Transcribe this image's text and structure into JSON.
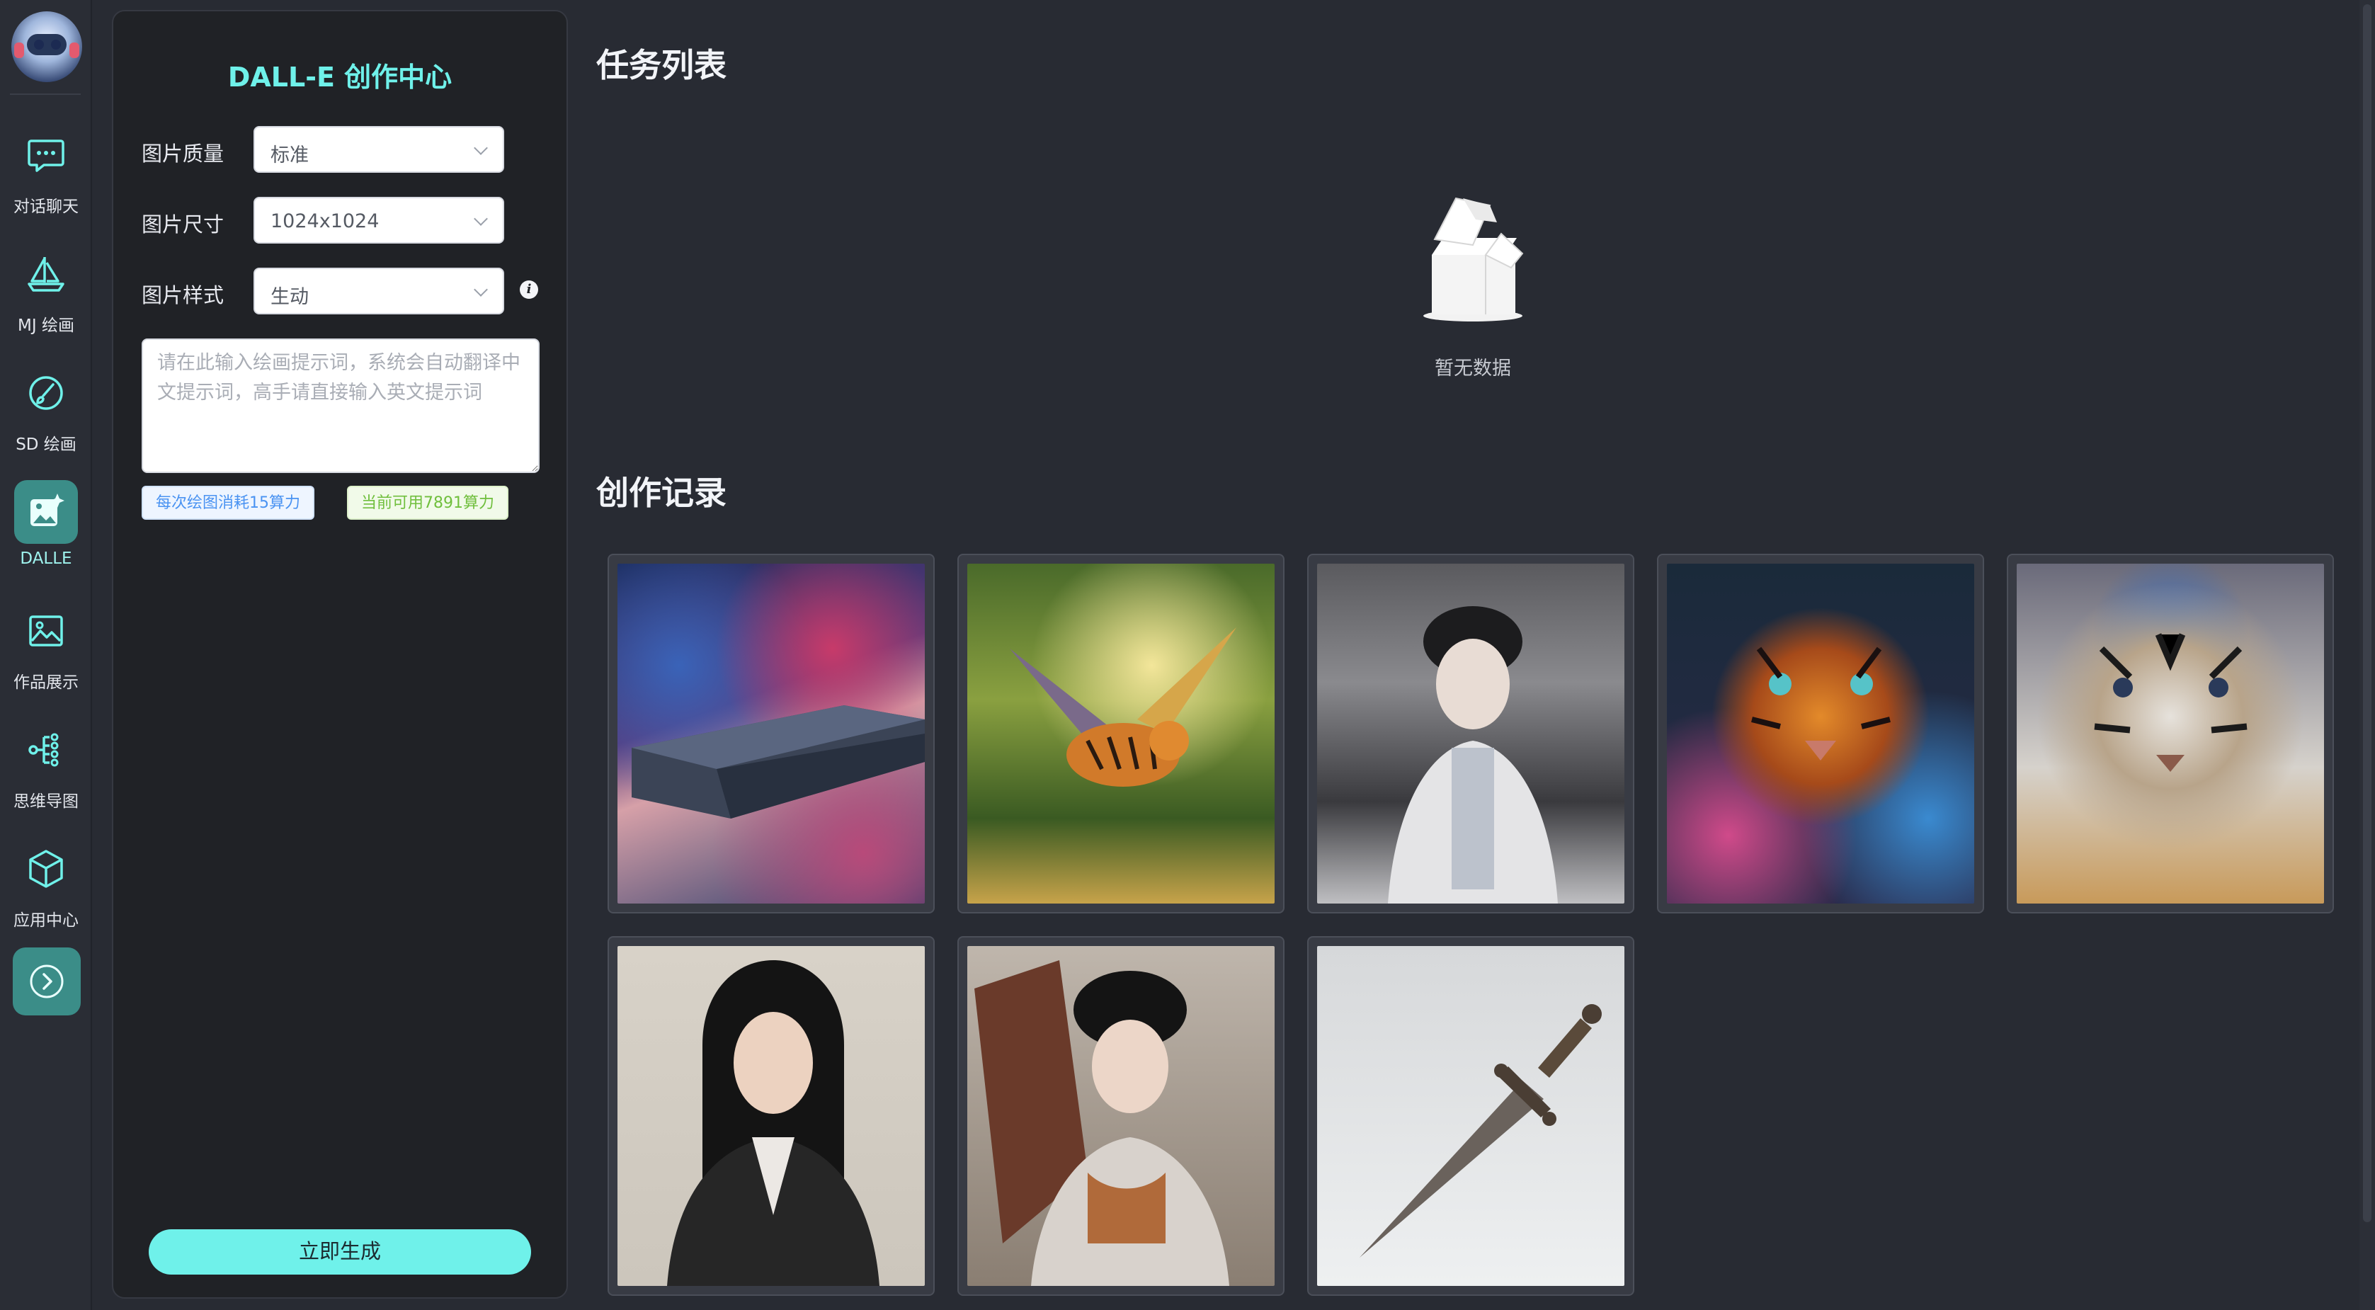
{
  "nav": {
    "items": [
      {
        "label": "对话聊天",
        "icon": "chat-icon"
      },
      {
        "label": "MJ 绘画",
        "icon": "sailboat-icon"
      },
      {
        "label": "SD 绘画",
        "icon": "brush-icon"
      },
      {
        "label": "DALLE",
        "icon": "image-sparkle-icon",
        "active": true
      },
      {
        "label": "作品展示",
        "icon": "gallery-icon"
      },
      {
        "label": "思维导图",
        "icon": "mindmap-icon"
      },
      {
        "label": "应用中心",
        "icon": "cube-icon"
      }
    ],
    "expand_icon": "chevron-right-circle-icon"
  },
  "panel": {
    "title": "DALL-E 创作中心",
    "quality": {
      "label": "图片质量",
      "value": "标准"
    },
    "size": {
      "label": "图片尺寸",
      "value": "1024x1024"
    },
    "style": {
      "label": "图片样式",
      "value": "生动"
    },
    "prompt_placeholder": "请在此输入绘画提示词，系统会自动翻译中文提示词，高手请直接输入英文提示词",
    "cost_tag": "每次绘图消耗15算力",
    "balance_tag": "当前可用7891算力",
    "generate_label": "立即生成"
  },
  "tasks": {
    "title": "任务列表",
    "empty_text": "暂无数据"
  },
  "records": {
    "title": "创作记录",
    "items": [
      {
        "subject": "spaceship-in-nebula"
      },
      {
        "subject": "winged-tiger-in-forest"
      },
      {
        "subject": "woman-in-hanfu"
      },
      {
        "subject": "tiger-with-colorful-smoke"
      },
      {
        "subject": "tiger-with-jewels"
      },
      {
        "subject": "woman-in-business-suit"
      },
      {
        "subject": "woman-in-traditional-dress"
      },
      {
        "subject": "dagger"
      }
    ]
  },
  "colors": {
    "accent": "#6ff1ea",
    "active_nav": "#3b8d88",
    "background": "#282b33",
    "panel": "#202226"
  }
}
